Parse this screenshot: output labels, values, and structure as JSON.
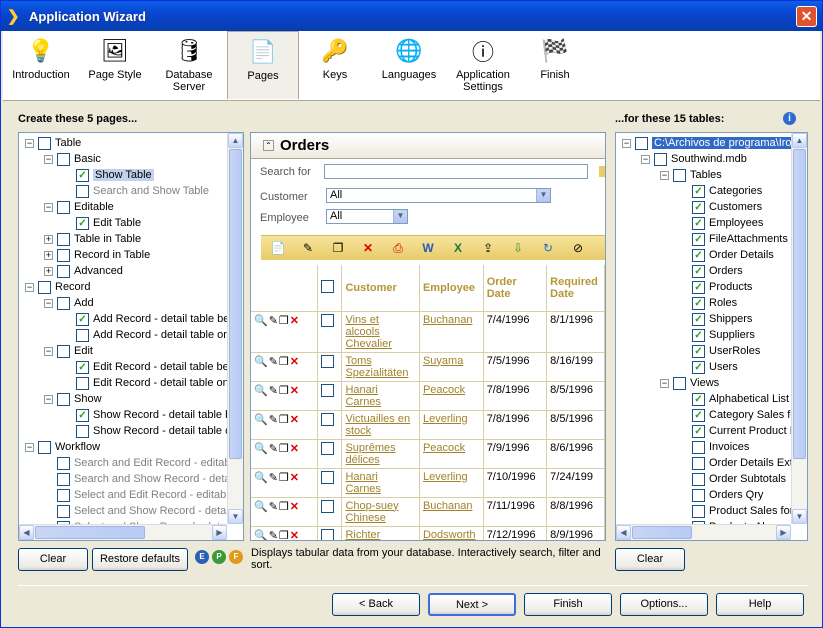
{
  "window": {
    "title": "Application Wizard"
  },
  "steps": [
    "Introduction",
    "Page Style",
    "Database Server",
    "Pages",
    "Keys",
    "Languages",
    "Application Settings",
    "Finish"
  ],
  "left": {
    "header": "Create these 5 pages...",
    "tree": [
      {
        "d": 0,
        "e": "−",
        "c": false,
        "t": "Table"
      },
      {
        "d": 1,
        "e": "−",
        "c": false,
        "t": "Basic"
      },
      {
        "d": 2,
        "e": "",
        "c": true,
        "t": "Show Table",
        "s": "focus"
      },
      {
        "d": 2,
        "e": "",
        "c": false,
        "t": "Search and Show Table",
        "g": true
      },
      {
        "d": 1,
        "e": "−",
        "c": false,
        "t": "Editable"
      },
      {
        "d": 2,
        "e": "",
        "c": true,
        "t": "Edit Table"
      },
      {
        "d": 1,
        "e": "+",
        "c": false,
        "t": "Table in Table"
      },
      {
        "d": 1,
        "e": "+",
        "c": false,
        "t": "Record in Table"
      },
      {
        "d": 1,
        "e": "+",
        "c": false,
        "t": "Advanced"
      },
      {
        "d": 0,
        "e": "−",
        "c": false,
        "t": "Record"
      },
      {
        "d": 1,
        "e": "−",
        "c": false,
        "t": "Add"
      },
      {
        "d": 2,
        "e": "",
        "c": true,
        "t": "Add Record - detail table be"
      },
      {
        "d": 2,
        "e": "",
        "c": false,
        "t": "Add Record - detail table or"
      },
      {
        "d": 1,
        "e": "−",
        "c": false,
        "t": "Edit"
      },
      {
        "d": 2,
        "e": "",
        "c": true,
        "t": "Edit Record - detail table be"
      },
      {
        "d": 2,
        "e": "",
        "c": false,
        "t": "Edit Record - detail table on"
      },
      {
        "d": 1,
        "e": "−",
        "c": false,
        "t": "Show"
      },
      {
        "d": 2,
        "e": "",
        "c": true,
        "t": "Show Record - detail table b"
      },
      {
        "d": 2,
        "e": "",
        "c": false,
        "t": "Show Record - detail table c"
      },
      {
        "d": 0,
        "e": "−",
        "c": false,
        "t": "Workflow"
      },
      {
        "d": 1,
        "e": "",
        "c": false,
        "t": "Search and Edit Record - editab",
        "g": true
      },
      {
        "d": 1,
        "e": "",
        "c": false,
        "t": "Search and Show Record - deta",
        "g": true
      },
      {
        "d": 1,
        "e": "",
        "c": false,
        "t": "Select and Edit Record - editabl",
        "g": true
      },
      {
        "d": 1,
        "e": "",
        "c": false,
        "t": "Select and Show Record - deta",
        "g": true
      },
      {
        "d": 1,
        "e": "",
        "c": false,
        "t": "Select and Show Record - deta",
        "g": true
      }
    ]
  },
  "right": {
    "header": "...for these 15 tables:",
    "tree": [
      {
        "d": 0,
        "e": "−",
        "c": false,
        "t": "C:\\Archivos de programa\\Iron",
        "s": "sel"
      },
      {
        "d": 1,
        "e": "−",
        "c": false,
        "t": "Southwind.mdb"
      },
      {
        "d": 2,
        "e": "−",
        "c": false,
        "t": "Tables"
      },
      {
        "d": 3,
        "e": "",
        "c": true,
        "t": "Categories"
      },
      {
        "d": 3,
        "e": "",
        "c": true,
        "t": "Customers"
      },
      {
        "d": 3,
        "e": "",
        "c": true,
        "t": "Employees"
      },
      {
        "d": 3,
        "e": "",
        "c": true,
        "t": "FileAttachments"
      },
      {
        "d": 3,
        "e": "",
        "c": true,
        "t": "Order Details"
      },
      {
        "d": 3,
        "e": "",
        "c": true,
        "t": "Orders"
      },
      {
        "d": 3,
        "e": "",
        "c": true,
        "t": "Products"
      },
      {
        "d": 3,
        "e": "",
        "c": true,
        "t": "Roles"
      },
      {
        "d": 3,
        "e": "",
        "c": true,
        "t": "Shippers"
      },
      {
        "d": 3,
        "e": "",
        "c": true,
        "t": "Suppliers"
      },
      {
        "d": 3,
        "e": "",
        "c": true,
        "t": "UserRoles"
      },
      {
        "d": 3,
        "e": "",
        "c": true,
        "t": "Users"
      },
      {
        "d": 2,
        "e": "−",
        "c": false,
        "t": "Views"
      },
      {
        "d": 3,
        "e": "",
        "c": true,
        "t": "Alphabetical List o"
      },
      {
        "d": 3,
        "e": "",
        "c": true,
        "t": "Category Sales for"
      },
      {
        "d": 3,
        "e": "",
        "c": true,
        "t": "Current Product Li"
      },
      {
        "d": 3,
        "e": "",
        "c": false,
        "t": "Invoices"
      },
      {
        "d": 3,
        "e": "",
        "c": false,
        "t": "Order Details Exte"
      },
      {
        "d": 3,
        "e": "",
        "c": false,
        "t": "Order Subtotals"
      },
      {
        "d": 3,
        "e": "",
        "c": false,
        "t": "Orders Qry"
      },
      {
        "d": 3,
        "e": "",
        "c": false,
        "t": "Product Sales for"
      },
      {
        "d": 3,
        "e": "",
        "c": false,
        "t": "Products Above A"
      }
    ]
  },
  "preview": {
    "title": "Orders",
    "search_label": "Search for",
    "customer_label": "Customer",
    "employee_label": "Employee",
    "customer_value": "All",
    "employee_value": "All",
    "columns": [
      "Customer",
      "Employee",
      "Order Date",
      "Required Date"
    ],
    "rows": [
      [
        "Vins et alcools Chevalier",
        "Buchanan",
        "7/4/1996",
        "8/1/1996"
      ],
      [
        "Toms Spezialitäten",
        "Suyama",
        "7/5/1996",
        "8/16/199"
      ],
      [
        "Hanari Carnes",
        "Peacock",
        "7/8/1996",
        "8/5/1996"
      ],
      [
        "Victuailles en stock",
        "Leverling",
        "7/8/1996",
        "8/5/1996"
      ],
      [
        "Suprêmes délices",
        "Peacock",
        "7/9/1996",
        "8/6/1996"
      ],
      [
        "Hanari Carnes",
        "Leverling",
        "7/10/1996",
        "7/24/199"
      ],
      [
        "Chop-suey Chinese",
        "Buchanan",
        "7/11/1996",
        "8/8/1996"
      ],
      [
        "Richter",
        "Dodsworth",
        "7/12/1996",
        "8/9/1996"
      ]
    ]
  },
  "buttons": {
    "clear": "Clear",
    "restore": "Restore defaults",
    "clear_right": "Clear",
    "back": "< Back",
    "next": "Next >",
    "finish": "Finish",
    "options": "Options...",
    "help": "Help"
  },
  "description": "Displays tabular data from your database. Interactively search, filter and sort.",
  "epf": [
    "E",
    "P",
    "F"
  ]
}
